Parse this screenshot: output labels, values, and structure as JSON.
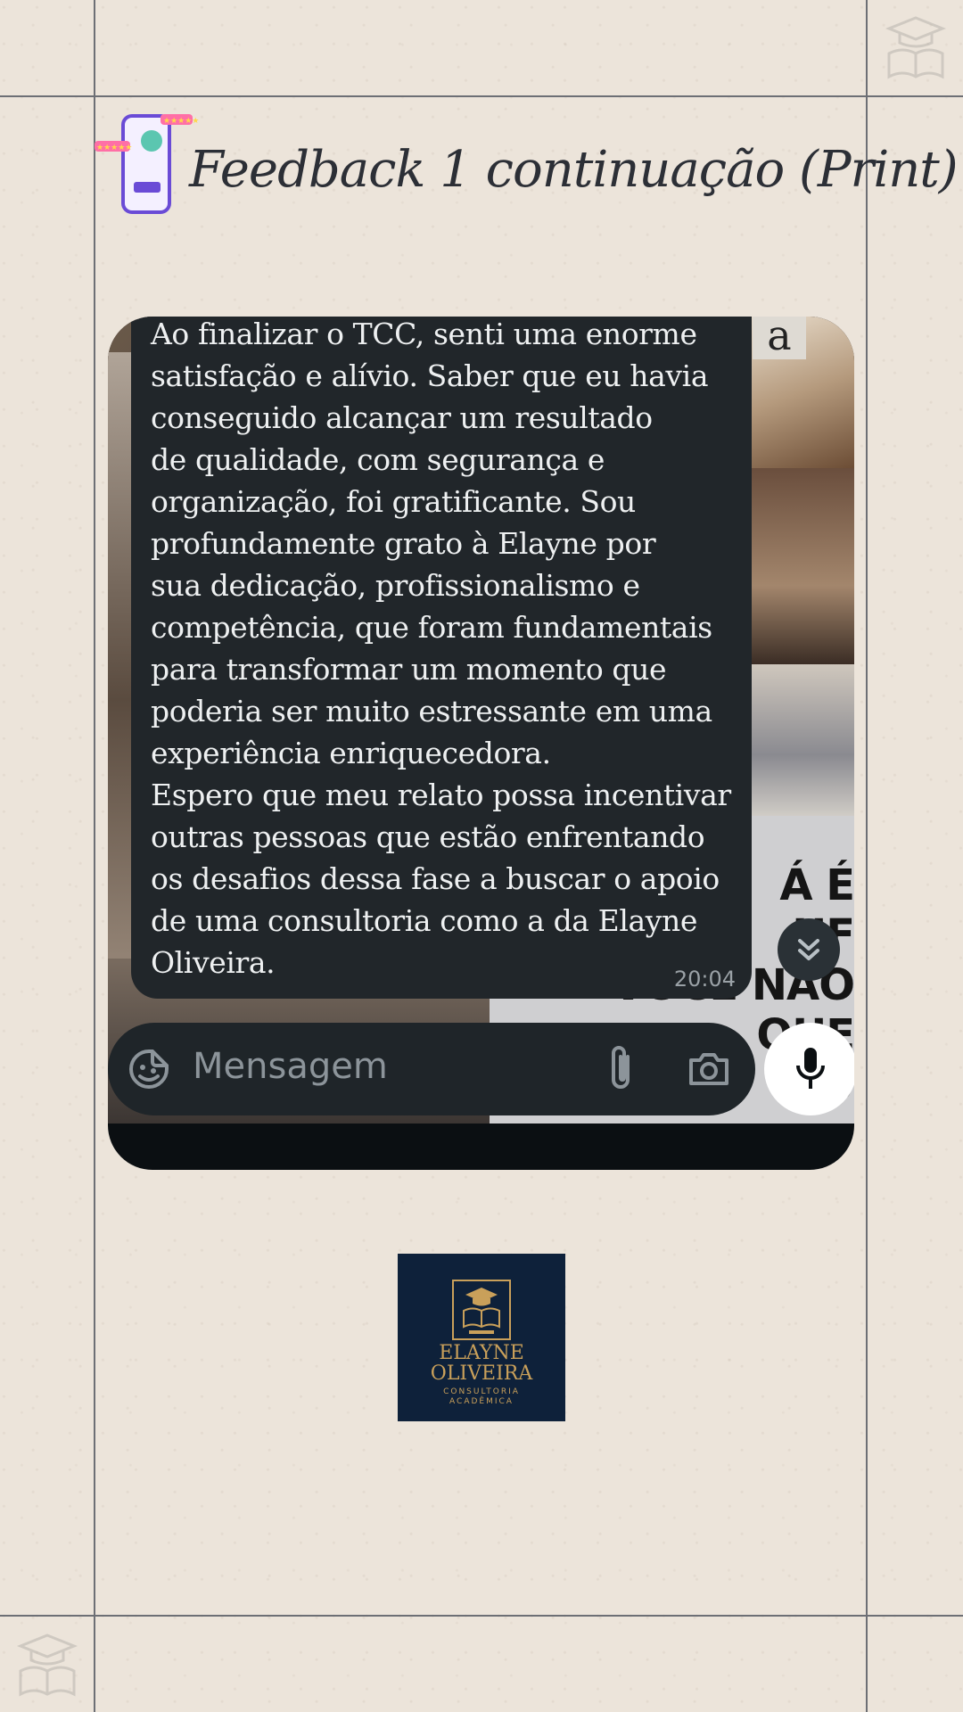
{
  "page": {
    "title": "Feedback 1 continuação (Print)"
  },
  "chat": {
    "message": {
      "text": "Ao finalizar o TCC, senti uma enorme\nsatisfação e alívio. Saber que eu havia\nconseguido alcançar um resultado\nde qualidade, com segurança e\norganização, foi gratificante. Sou\nprofundamente grato à Elayne por\nsua dedicação, profissionalismo e\ncompetência, que foram fundamentais\npara transformar um momento que\npoderia ser muito estressante em uma\nexperiência enriquecedora.\nEspero que meu relato possa incentivar\noutras pessoas que estão enfrentando\nos desafios dessa fase a buscar o apoio\nde uma consultoria como a da Elayne\nOliveira.",
      "time": "20:04"
    },
    "background_text": "Á É\nUF\nVOCÊ NÃO QUE\nO U",
    "background_letter": "a",
    "input": {
      "placeholder": "Mensagem"
    },
    "icons": {
      "emoji": "sticker-icon",
      "attach": "paperclip-icon",
      "camera": "camera-icon",
      "mic": "microphone-icon",
      "scroll": "double-chevron-down-icon"
    }
  },
  "logo": {
    "name": "ELAYNE\nOLIVEIRA",
    "subtitle": "CONSULTORIA\nACADÊMICA"
  },
  "colors": {
    "background": "#ece4da",
    "grid_lines": "#6d6f75",
    "bubble": "#21262a",
    "logo_bg": "#0e213a",
    "logo_gold": "#c9a05a"
  }
}
